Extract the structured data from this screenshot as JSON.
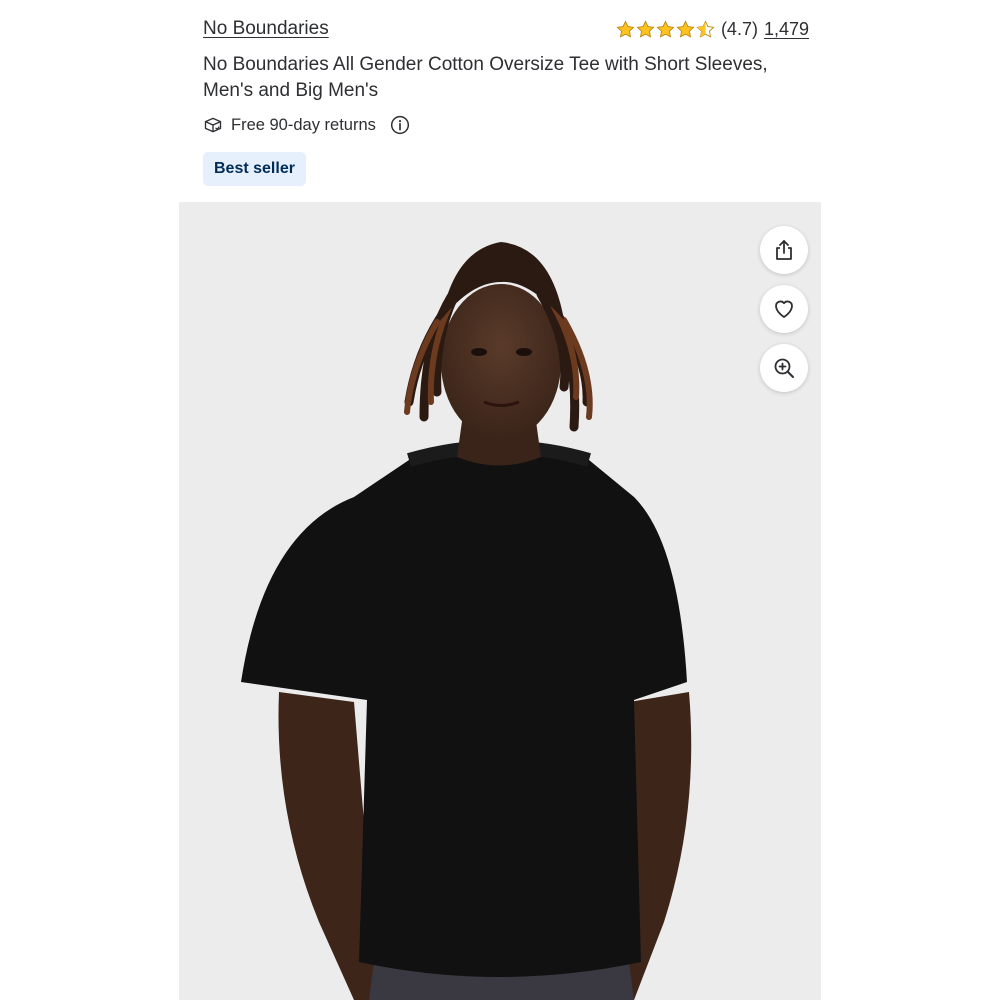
{
  "product": {
    "brand": "No Boundaries",
    "rating_text": "(4.7)",
    "rating_value": 4.7,
    "review_count": "1,479",
    "title": "No Boundaries All Gender Cotton Oversize Tee with Short Sleeves, Men's and Big Men's",
    "returns_text": "Free 90-day returns",
    "badge": "Best seller"
  },
  "icons": {
    "returns": "returns-box-icon",
    "info": "info-icon",
    "share": "share-icon",
    "favorite": "heart-icon",
    "zoom": "zoom-in-icon"
  },
  "colors": {
    "text": "#2e2f32",
    "star": "#ffc220",
    "badge_bg": "#e6effc",
    "badge_text": "#002d58",
    "gallery_bg": "#ececec"
  }
}
